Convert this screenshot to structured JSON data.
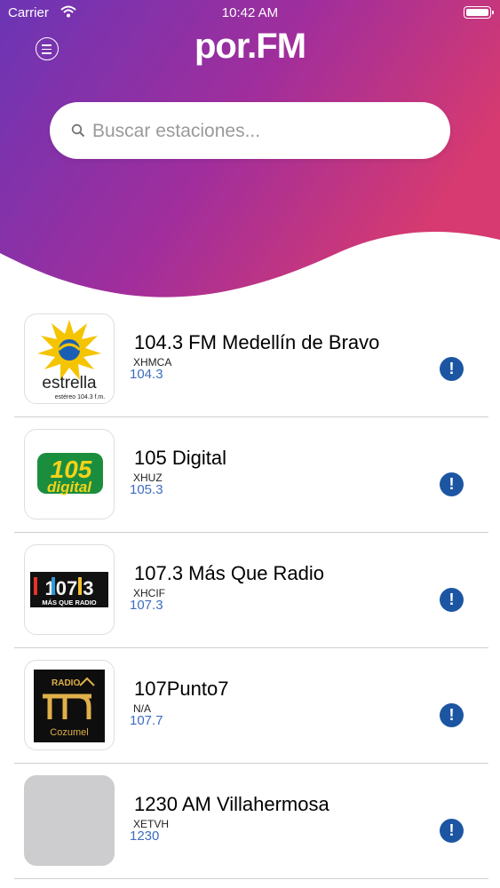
{
  "status_bar": {
    "carrier": "Carrier",
    "time": "10:42 AM"
  },
  "header": {
    "logo_text": "por.FM",
    "menu_icon": "menu-icon",
    "gradient": [
      "#6b35b5",
      "#a12e9c",
      "#d13a6f"
    ]
  },
  "search": {
    "placeholder": "Buscar estaciones..."
  },
  "colors": {
    "frequency_text": "#3d6cbf",
    "info_icon": "#1c56a3",
    "divider": "#cfcfcf"
  },
  "stations": [
    {
      "name": "104.3 FM Medellín de Bravo",
      "callsign": "XHMCA",
      "frequency": "104.3",
      "logo": "estrella-logo",
      "logo_text": "estrella",
      "logo_subtext": "estéreo 104.3 f.m."
    },
    {
      "name": "105 Digital",
      "callsign": "XHUZ",
      "frequency": "105.3",
      "logo": "105-digital-logo",
      "logo_text": "105",
      "logo_subtext": "digital"
    },
    {
      "name": "107.3 Más Que Radio",
      "callsign": "XHCIF",
      "frequency": "107.3",
      "logo": "107-3-logo",
      "logo_text": "107.3",
      "logo_subtext": "MÁS QUE RADIO"
    },
    {
      "name": "107Punto7",
      "callsign": "N/A",
      "frequency": "107.7",
      "logo": "radio-cozumel-logo",
      "logo_text": "RADIO",
      "logo_subtext": "Cozumel"
    },
    {
      "name": "1230 AM Villahermosa",
      "callsign": "XETVH",
      "frequency": "1230",
      "logo": "placeholder-logo"
    }
  ]
}
